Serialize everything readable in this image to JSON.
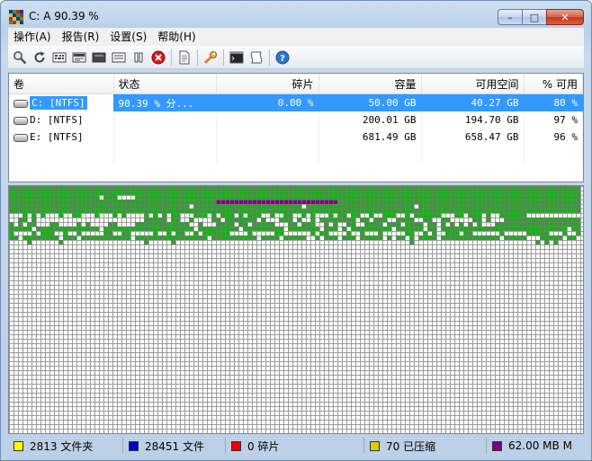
{
  "window": {
    "title": "C:  A  90.39 %",
    "min_label": "–",
    "max_label": "□",
    "close_label": "✕"
  },
  "menu": [
    {
      "id": "action",
      "label": "操作(A)"
    },
    {
      "id": "report",
      "label": "报告(R)"
    },
    {
      "id": "settings",
      "label": "设置(S)"
    },
    {
      "id": "help",
      "label": "帮助(H)"
    }
  ],
  "toolbar": {
    "icons": [
      "analyze-icon",
      "refresh-icon",
      "defrag-icon",
      "full-optimize-icon",
      "mft-optimize-icon",
      "quick-optimize-icon",
      "pause-icon",
      "stop-icon",
      "report-icon",
      "settings-icon",
      "console-icon",
      "script-icon",
      "help-icon"
    ]
  },
  "drives": {
    "columns": [
      "卷",
      "状态",
      "碎片",
      "容量",
      "可用空间",
      "% 可用"
    ],
    "rows": [
      {
        "volume": "C: [NTFS]",
        "status": "90.39 % 分...",
        "fragmented": "0.00 %",
        "capacity": "50.00 GB",
        "free": "40.27 GB",
        "pct_free": "80 %",
        "selected": true
      },
      {
        "volume": "D: [NTFS]",
        "status": "",
        "fragmented": "",
        "capacity": "200.01 GB",
        "free": "194.70 GB",
        "pct_free": "97 %",
        "selected": false
      },
      {
        "volume": "E: [NTFS]",
        "status": "",
        "fragmented": "",
        "capacity": "681.49 GB",
        "free": "658.47 GB",
        "pct_free": "96 %",
        "selected": false
      }
    ]
  },
  "cluster_map": {
    "colors": {
      "used": "#22aa22",
      "free": "#ffffff",
      "mft": "#800080",
      "grid": "#7a7a7a"
    }
  },
  "status": {
    "items": [
      {
        "id": "folders",
        "text": "2813 文件夹",
        "color": "#ffff00"
      },
      {
        "id": "files",
        "text": "28451 文件",
        "color": "#0000cc"
      },
      {
        "id": "fragmented",
        "text": "0 碎片",
        "color": "#ee0000"
      },
      {
        "id": "compressed",
        "text": "70 已压缩",
        "color": "#ddcc00"
      },
      {
        "id": "mft",
        "text": "62.00 MB M",
        "color": "#800080"
      }
    ]
  }
}
